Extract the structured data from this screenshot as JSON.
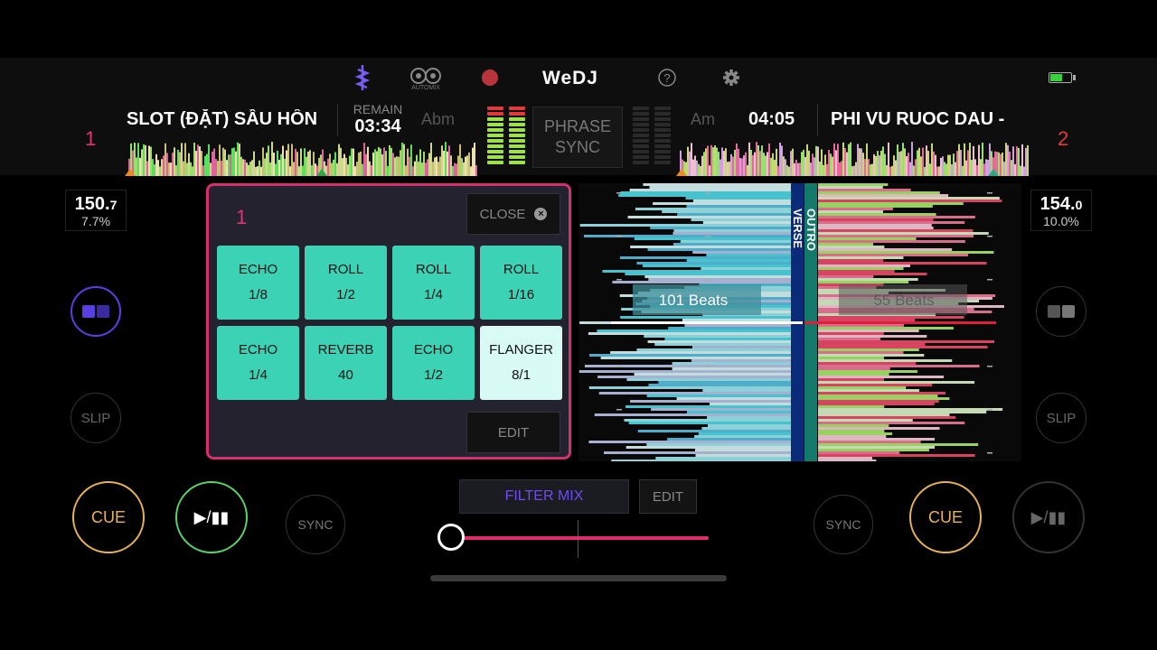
{
  "app": {
    "logo": "WeDJ",
    "automix_label": "AUTOMIX"
  },
  "colors": {
    "accent_pink": "#e6336f",
    "pad": "#3cd2b5",
    "pad_active": "#d8fbf6",
    "cue": "#e8b25a",
    "play": "#59d36a",
    "filter_mix": "#6f4cf0"
  },
  "deck1": {
    "number": "1",
    "title": "SLOT (ĐẶT) SẦU HỒN",
    "remain_label": "REMAIN",
    "time": "03:34",
    "key": "Abm",
    "bpm_main": "150.",
    "bpm_decimal": "7",
    "pitch": "7.7%",
    "slip": "SLIP",
    "cue": "CUE",
    "play": "▶/▮▮",
    "sync": "SYNC"
  },
  "deck2": {
    "number": "2",
    "title": "PHI VU RUOC DAU -",
    "key": "Am",
    "time": "04:05",
    "bpm_main": "154.",
    "bpm_decimal": "0",
    "pitch": "10.0%",
    "slip": "SLIP",
    "cue": "CUE",
    "play": "▶/▮▮",
    "sync": "SYNC"
  },
  "center": {
    "phrase_sync_line1": "PHRASE",
    "phrase_sync_line2": "SYNC"
  },
  "fx_panel": {
    "deck": "1",
    "close_label": "CLOSE",
    "edit_label": "EDIT",
    "pads": [
      {
        "name": "ECHO",
        "value": "1/8",
        "active": false
      },
      {
        "name": "ROLL",
        "value": "1/2",
        "active": false
      },
      {
        "name": "ROLL",
        "value": "1/4",
        "active": false
      },
      {
        "name": "ROLL",
        "value": "1/16",
        "active": false
      },
      {
        "name": "ECHO",
        "value": "1/4",
        "active": false
      },
      {
        "name": "REVERB",
        "value": "40",
        "active": false
      },
      {
        "name": "ECHO",
        "value": "1/2",
        "active": false
      },
      {
        "name": "FLANGER",
        "value": "8/1",
        "active": true
      }
    ]
  },
  "waveform": {
    "left_beats": "101 Beats",
    "right_beats": "55 Beats",
    "phrase_a": "VERSE",
    "phrase_b": "OUTRO"
  },
  "bottom": {
    "filter_mix": "FILTER MIX",
    "edit": "EDIT",
    "crossfader": 0.0
  }
}
